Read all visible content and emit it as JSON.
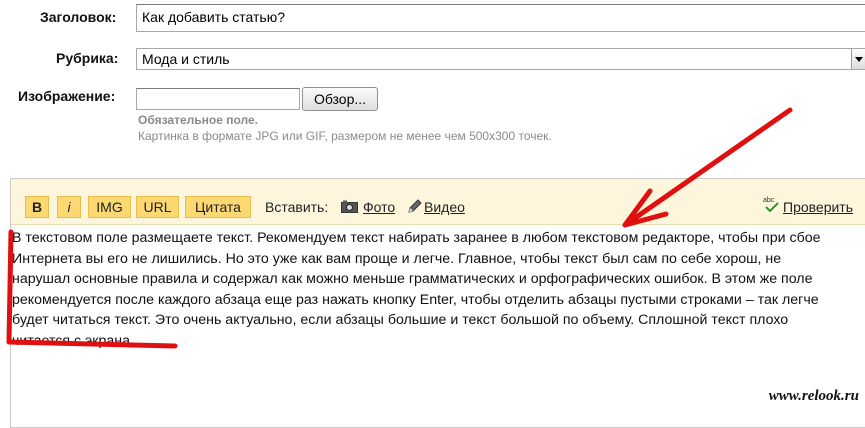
{
  "form": {
    "title_label": "Заголовок:",
    "title_value": "Как добавить статью?",
    "rubric_label": "Рубрика:",
    "rubric_value": "Мода и стиль",
    "image_label": "Изображение:",
    "browse_label": "Обзор...",
    "required_hint": "Обязательное поле.",
    "format_hint": "Картинка в формате JPG или GIF, размером не менее чем 500x300 точек."
  },
  "toolbar": {
    "bold": "B",
    "italic": "i",
    "img": "IMG",
    "url": "URL",
    "quote": "Цитата",
    "insert_label": "Вставить:",
    "photo": "Фото",
    "video": "Видео",
    "check": "Проверить",
    "icons": [
      "camera-icon",
      "pencil-icon",
      "spellcheck-icon"
    ]
  },
  "editor": {
    "line1": "В текстовом поле размещаете текст. Рекомендуем текст набирать заранее в любом текстовом редакторе, чтобы при сбое",
    "line2": "Интернета вы его не лишились. Но это уже как вам проще и легче. Главное, чтобы текст был сам по себе хорош, не",
    "line3": "нарушал основные правила и содержал как можно меньше грамматических и орфографических ошибок. В этом же поле",
    "line4": "рекомендуется после каждого абзаца еще раз нажать кнопку Enter, чтобы отделить абзацы пустыми строками – так легче",
    "line5": "будет читаться текст. Это очень актуально, если абзацы большие и текст большой по объему. Сплошной текст плохо",
    "line6": "читается с экрана."
  },
  "watermark": "www.relook.ru",
  "colors": {
    "toolbar_bg": "#fdf6dc",
    "button_bg": "#fcd873",
    "annotation_red": "#e01010",
    "hint_gray": "#8a8a8a"
  }
}
